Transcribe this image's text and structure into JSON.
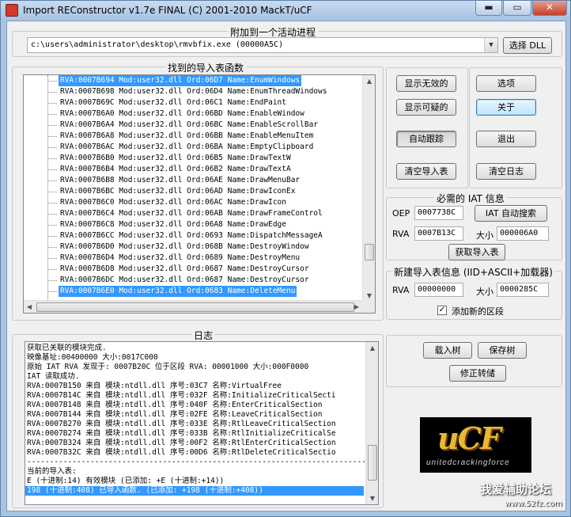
{
  "window": {
    "title": "Import REConstructor v1.7e FINAL (C) 2001-2010 MackT/uCF",
    "buttons": {
      "minimize": "▬",
      "maximize": "▭",
      "close": "✕"
    }
  },
  "attach": {
    "label": "附加到一个活动进程",
    "process": "c:\\users\\administrator\\desktop\\rmvbfix.exe (00000A5C)",
    "dll_button": "选择 DLL"
  },
  "imports": {
    "label": "找到的导入表函数",
    "rows": [
      "RVA:0007B694 Mod:user32.dll Ord:06D7 Name:EnumWindows",
      "RVA:0007B698 Mod:user32.dll Ord:06D4 Name:EnumThreadWindows",
      "RVA:0007B69C Mod:user32.dll Ord:06C1 Name:EndPaint",
      "RVA:0007B6A0 Mod:user32.dll Ord:06BD Name:EnableWindow",
      "RVA:0007B6A4 Mod:user32.dll Ord:06BC Name:EnableScrollBar",
      "RVA:0007B6A8 Mod:user32.dll Ord:06BB Name:EnableMenuItem",
      "RVA:0007B6AC Mod:user32.dll Ord:06BA Name:EmptyClipboard",
      "RVA:0007B6B0 Mod:user32.dll Ord:06B5 Name:DrawTextW",
      "RVA:0007B6B4 Mod:user32.dll Ord:06B2 Name:DrawTextA",
      "RVA:0007B6B8 Mod:user32.dll Ord:06AE Name:DrawMenuBar",
      "RVA:0007B6BC Mod:user32.dll Ord:06AD Name:DrawIconEx",
      "RVA:0007B6C0 Mod:user32.dll Ord:06AC Name:DrawIcon",
      "RVA:0007B6C4 Mod:user32.dll Ord:06AB Name:DrawFrameControl",
      "RVA:0007B6C8 Mod:user32.dll Ord:06A8 Name:DrawEdge",
      "RVA:0007B6CC Mod:user32.dll Ord:0693 Name:DispatchMessageA",
      "RVA:0007B6D0 Mod:user32.dll Ord:068B Name:DestroyWindow",
      "RVA:0007B6D4 Mod:user32.dll Ord:0689 Name:DestroyMenu",
      "RVA:0007B6D8 Mod:user32.dll Ord:0687 Name:DestroyCursor",
      "RVA:0007B6DC Mod:user32.dll Ord:0687 Name:DestroyCursor",
      "RVA:0007B6E0 Mod:user32.dll Ord:0683 Name:DeleteMenu"
    ]
  },
  "buttons": {
    "show_invalid": "显示无效的",
    "show_suspect": "显示可疑的",
    "auto_trace": "自动跟踪",
    "clear_imports": "清空导入表",
    "options": "选项",
    "about": "关于",
    "exit": "退出",
    "clear_log": "清空日志"
  },
  "iat": {
    "label": "必需的 IAT 信息",
    "oep_label": "OEP",
    "oep": "0007738C",
    "autosearch": "IAT 自动搜索",
    "rva_label": "RVA",
    "rva": "0007B13C",
    "size_label": "大小",
    "size": "000006A0",
    "get_imports": "获取导入表"
  },
  "newimport": {
    "label": "新建导入表信息 (IID+ASCII+加载器)",
    "rva_label": "RVA",
    "rva": "00000000",
    "size_label": "大小",
    "size": "0000285C",
    "add_section": "添加新的区段",
    "checked": "✓"
  },
  "log": {
    "label": "日志",
    "lines": [
      "获取已关联的模块完成.",
      "映像基址:00400000 大小:0017C000",
      "原始 IAT RVA 发现于: 0007B20C 位于区段 RVA: 00001000 大小:000F0000",
      "IAT 读取成功.",
      "RVA:0007B150 来自 模块:ntdll.dll 序号:03C7 名称:VirtualFree",
      "RVA:0007B14C 来自 模块:ntdll.dll 序号:032F 名称:InitializeCriticalSecti",
      "RVA:0007B148 来自 模块:ntdll.dll 序号:040F 名称:EnterCriticalSection",
      "RVA:0007B144 来自 模块:ntdll.dll 序号:02FE 名称:LeaveCriticalSection",
      "RVA:0007B270 来自 模块:ntdll.dll 序号:033E 名称:RtlLeaveCriticalSection",
      "RVA:0007B274 来自 模块:ntdll.dll 序号:033B 名称:RtlInitializeCriticalSe",
      "RVA:0007B324 来自 模块:ntdll.dll 序号:00F2 名称:RtlEnterCriticalSection",
      "RVA:0007B32C 来自 模块:ntdll.dll 序号:00D6 名称:RtlDeleteCriticalSectio",
      "------------------------------------------------------------------------------",
      "当前的导入表:",
      "E (十进制:14) 有效模块 (已添加: +E (十进制:+14))",
      "198 (十进制:408) 已导入函数. (已添加: +198 (十进制:+408))"
    ]
  },
  "tree_actions": {
    "load_tree": "载入树",
    "save_tree": "保存树",
    "fix_dump": "修正转储"
  },
  "logo": {
    "big": "uCF",
    "small": "unitedcrackingforce"
  },
  "watermark": {
    "main": "我爱辅助论坛",
    "url": "www.52fz.com"
  }
}
